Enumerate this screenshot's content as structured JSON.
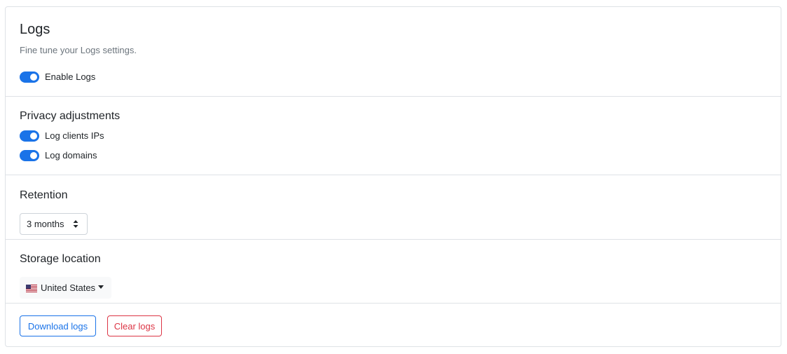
{
  "colors": {
    "accent": "#1a73e8",
    "danger": "#dc3545",
    "border": "#dee2e6",
    "muted_text": "#6c757d"
  },
  "logs": {
    "title": "Logs",
    "subtitle": "Fine tune your Logs settings.",
    "enable_label": "Enable Logs",
    "enable_on": true
  },
  "privacy": {
    "heading": "Privacy adjustments",
    "log_ips_label": "Log clients IPs",
    "log_ips_on": true,
    "log_domains_label": "Log domains",
    "log_domains_on": true
  },
  "retention": {
    "heading": "Retention",
    "selected": "3 months",
    "icon": "sort-arrows-icon"
  },
  "storage": {
    "heading": "Storage location",
    "selected": "United States",
    "icon": "us-flag-icon"
  },
  "actions": {
    "download_label": "Download logs",
    "clear_label": "Clear logs"
  }
}
